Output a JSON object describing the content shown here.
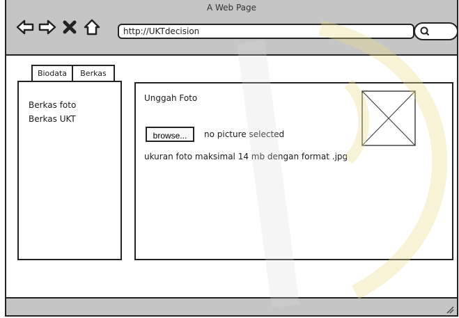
{
  "window": {
    "title": "A Web Page"
  },
  "toolbar": {
    "back_icon": "back-arrow-icon",
    "forward_icon": "forward-arrow-icon",
    "stop_icon": "close-icon",
    "home_icon": "home-icon",
    "url": "http://UKTdecision",
    "search_icon": "search-icon"
  },
  "tabs": [
    {
      "label": "Biodata"
    },
    {
      "label": "Berkas"
    }
  ],
  "sidebar": {
    "items": [
      {
        "label": "Berkas foto"
      },
      {
        "label": "Berkas UKT"
      }
    ]
  },
  "upload": {
    "title": "Unggah Foto",
    "browse_label": "browse...",
    "status": "no picture selected",
    "note": "ukuran foto maksimal 14 mb dengan format .jpg",
    "placeholder_icon": "image-placeholder-icon"
  },
  "colors": {
    "chrome": "#c5c5c5",
    "border": "#222222",
    "watermark": "#e8d98a"
  }
}
